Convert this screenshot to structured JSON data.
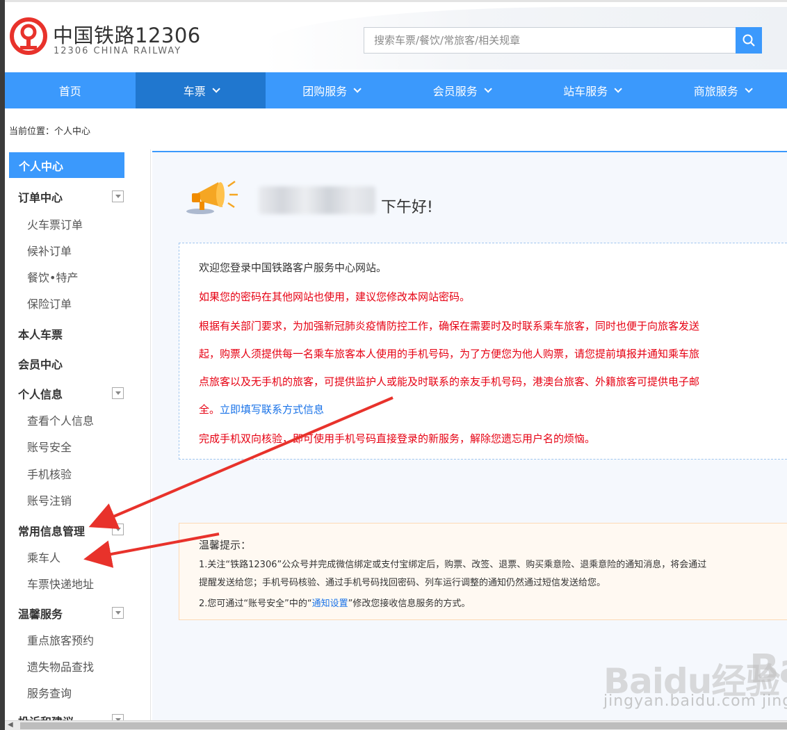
{
  "header": {
    "logo_cn": "中国铁路12306",
    "logo_en": "12306 CHINA RAILWAY",
    "search_placeholder": "搜索车票/餐饮/常旅客/相关规章"
  },
  "nav": {
    "items": [
      {
        "label": "首页"
      },
      {
        "label": "车票"
      },
      {
        "label": "团购服务"
      },
      {
        "label": "会员服务"
      },
      {
        "label": "站车服务"
      },
      {
        "label": "商旅服务"
      }
    ]
  },
  "breadcrumb": "当前位置：个人中心",
  "sidebar": {
    "active": "个人中心",
    "order_center": "订单中心",
    "order_items": [
      "火车票订单",
      "候补订单",
      "餐饮•特产",
      "保险订单"
    ],
    "my_tickets": "本人车票",
    "member_center": "会员中心",
    "personal_info": "个人信息",
    "personal_items": [
      "查看个人信息",
      "账号安全",
      "手机核验",
      "账号注销"
    ],
    "common_info": "常用信息管理",
    "common_items": [
      "乘车人",
      "车票快递地址"
    ],
    "warm_service": "温馨服务",
    "warm_items": [
      "重点旅客预约",
      "遗失物品查找",
      "服务查询"
    ],
    "complaint": "投诉和建议"
  },
  "main": {
    "greeting": "下午好!",
    "notice": {
      "welcome": "欢迎您登录中国铁路客户服务中心网站。",
      "password_tip": "如果您的密码在其他网站也使用，建议您修改本网站密码。",
      "line1": "根据有关部门要求，为加强新冠肺炎疫情防控工作，确保在需要时及时联系乘车旅客，同时也便于向旅客发送",
      "line2": "起，购票人须提供每一名乘车旅客本人使用的手机号码，为了方便您为他人购票，请您提前填报并通知乘车旅",
      "line3": "点旅客以及无手机的旅客，可提供监护人或能及时联系的亲友手机号码，港澳台旅客、外籍旅客可提供电子邮",
      "line4_prefix": "全。",
      "line4_link": "立即填写联系方式信息",
      "line5": "完成手机双向核验，即可使用手机号码直接登录的新服务，解除您遗忘用户名的烦恼。"
    },
    "tips": {
      "title": "温馨提示：",
      "line1": "1.关注“铁路12306”公众号并完成微信绑定或支付宝绑定后，购票、改签、退票、购买乘意险、退乘意险的通知消息，将会通过",
      "line2": "提醒发送给您；手机号码核验、通过手机号码找回密码、列车运行调整的通知仍然通过短信发送给您。",
      "line3_prefix": "2.您可通过“账号安全”中的“",
      "line3_link": "通知设置",
      "line3_suffix": "”修改您接收信息服务的方式。"
    }
  },
  "watermark": {
    "logo": "Baidu经验",
    "logo_tail": "Ba",
    "url": "jingyan.baidu.com",
    "url_tail": "jing"
  },
  "colors": {
    "brand_blue": "#3b99fc",
    "nav_active": "#2077cf",
    "notice_red": "#e60012",
    "link_blue": "#1a73e8",
    "annotation_red": "#e8322b"
  }
}
